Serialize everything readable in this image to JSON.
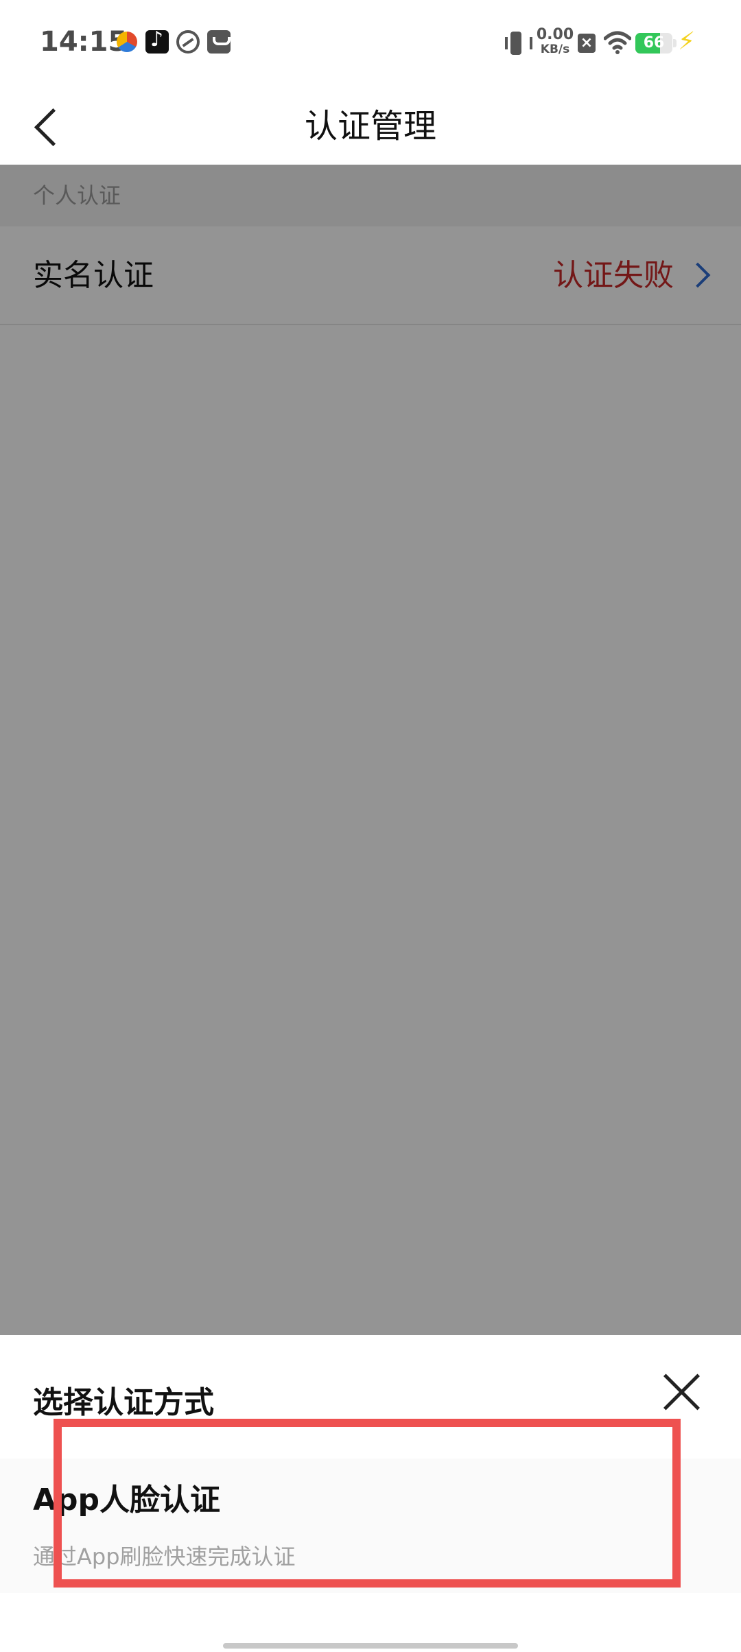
{
  "status_bar": {
    "time": "14:15",
    "net_speed_value": "0.00",
    "net_speed_unit": "KB/s",
    "battery_level": "66",
    "battery_percent": 66,
    "icons": [
      "app-icon",
      "tiktok-icon",
      "circle-app-icon",
      "mail-icon",
      "vibrate-icon",
      "close-box-icon",
      "wifi-icon",
      "battery-icon",
      "charging-bolt-icon"
    ]
  },
  "nav": {
    "title": "认证管理"
  },
  "section": {
    "header": "个人认证"
  },
  "list": {
    "items": [
      {
        "label": "实名认证",
        "status": "认证失败",
        "status_color": "#c62828"
      }
    ]
  },
  "sheet": {
    "title": "选择认证方式",
    "options": [
      {
        "title": "App人脸认证",
        "description": "通过App刷脸快速完成认证"
      }
    ]
  },
  "colors": {
    "highlight": "#ee5150",
    "chevron": "#2f6bd1",
    "battery": "#32c759"
  }
}
